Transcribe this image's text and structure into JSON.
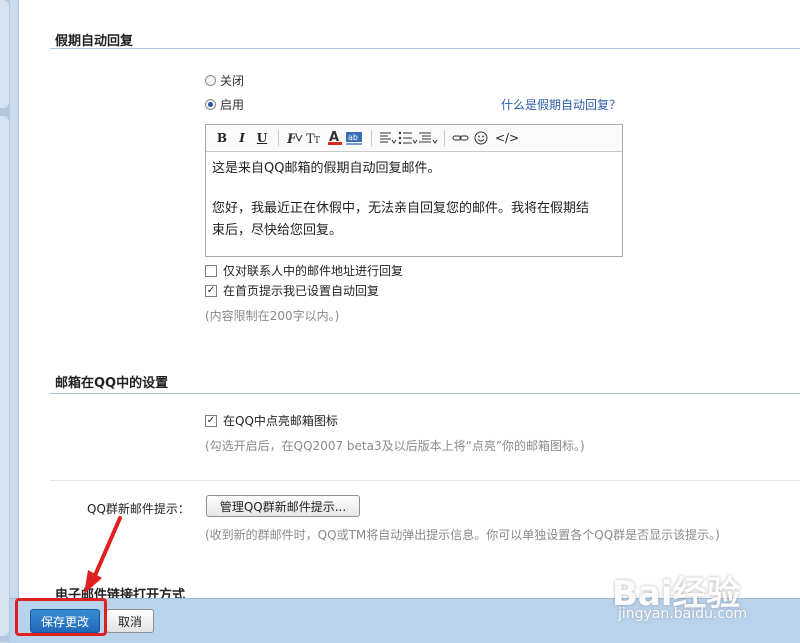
{
  "vacation_section": {
    "title": "假期自动回复",
    "option_off": "关闭",
    "option_on": "启用",
    "help_link": "什么是假期自动回复？",
    "editor_lines": [
      "这是来自QQ邮箱的假期自动回复邮件。",
      "您好，我最近正在休假中，无法亲自回复您的邮件。我将在假期结",
      "束后，尽快给您回复。"
    ],
    "toolbar": {
      "bold": "B",
      "italic": "I",
      "underline": "U",
      "code": "</>"
    },
    "checkbox_contacts_only": "仅对联系人中的邮件地址进行回复",
    "checkbox_homepage_notice": "在首页提示我已设置自动回复",
    "limit_hint": "(内容限制在200字以内。)"
  },
  "qq_section": {
    "title": "邮箱在QQ中的设置",
    "checkbox_light_icon": "在QQ中点亮邮箱图标",
    "light_icon_hint": "(勾选开启后，在QQ2007 beta3及以后版本上将“点亮”你的邮箱图标。)",
    "group_label": "QQ群新邮件提示：",
    "group_button": "管理QQ群新邮件提示...",
    "group_hint": "(收到新的群邮件时，QQ或TM将自动弹出提示信息。你可以单独设置各个QQ群是否显示该提示。)"
  },
  "link_section": {
    "title": "电子邮件链接打开方式"
  },
  "footer": {
    "save_label": "保存更改",
    "cancel_label": "取消"
  },
  "watermark": {
    "brand": "Bai经验",
    "url": "jingyan.baidu.com"
  },
  "colors": {
    "accent": "#2a5caa",
    "highlight": "#e02020",
    "save_button": "#2a78c8"
  }
}
